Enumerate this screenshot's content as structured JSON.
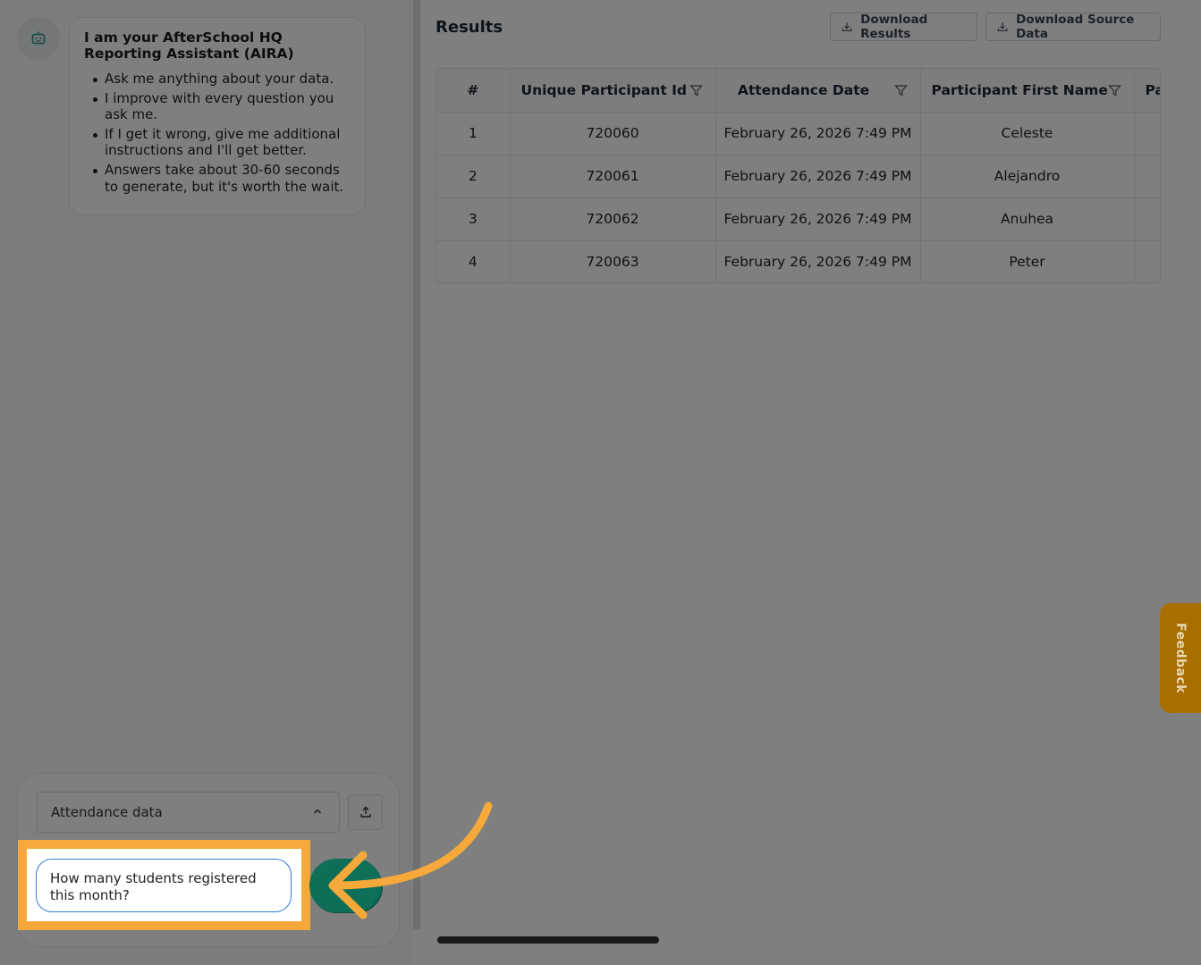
{
  "chat": {
    "intro_title": "I am your AfterSchool HQ Reporting Assistant (AIRA)",
    "intro_points": [
      "Ask me anything about your data.",
      "I improve with every question you ask me.",
      "If I get it wrong, give me additional instructions and I'll get better.",
      "Answers take about 30-60 seconds to generate, but it's worth the wait."
    ],
    "dataset_selected": "Attendance data",
    "query_value": "How many students registered this month?"
  },
  "results": {
    "title": "Results",
    "download_results_label": "Download Results",
    "download_source_label": "Download Source Data",
    "columns": [
      "#",
      "Unique Participant Id",
      "Attendance Date",
      "Participant First Name",
      "Pa"
    ],
    "rows": [
      [
        "1",
        "720060",
        "February 26, 2026 7:49 PM",
        "Celeste",
        ""
      ],
      [
        "2",
        "720061",
        "February 26, 2026 7:49 PM",
        "Alejandro",
        ""
      ],
      [
        "3",
        "720062",
        "February 26, 2026 7:49 PM",
        "Anuhea",
        ""
      ],
      [
        "4",
        "720063",
        "February 26, 2026 7:49 PM",
        "Peter",
        ""
      ]
    ]
  },
  "feedback_label": "Feedback",
  "colors": {
    "accent_green": "#0e9e7e",
    "highlight_orange": "#f6a93b",
    "feedback_bg": "#a86e00"
  }
}
